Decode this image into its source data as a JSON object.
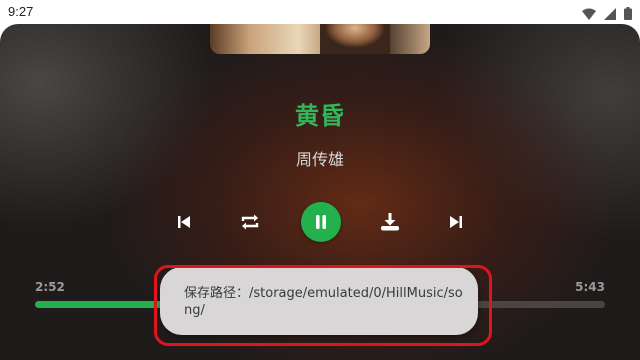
{
  "status_bar": {
    "time": "9:27",
    "icons": [
      "wifi-icon",
      "cellular-signal-icon",
      "battery-icon"
    ]
  },
  "song": {
    "title": "黄昏",
    "artist": "周传雄"
  },
  "controls": [
    {
      "name": "previous-button",
      "icon": "skip-previous-icon"
    },
    {
      "name": "repeat-button",
      "icon": "repeat-icon"
    },
    {
      "name": "play-pause-button",
      "icon": "pause-icon"
    },
    {
      "name": "download-button",
      "icon": "download-icon"
    },
    {
      "name": "next-button",
      "icon": "skip-next-icon"
    }
  ],
  "progress": {
    "elapsed": "2:52",
    "duration": "5:43",
    "fraction": 0.5
  },
  "toast": {
    "message": "保存路径：/storage/emulated/0/HillMusic/song/"
  },
  "colors": {
    "accent": "#22b14c",
    "title": "#2fb75a",
    "highlight": "#e0141c"
  }
}
